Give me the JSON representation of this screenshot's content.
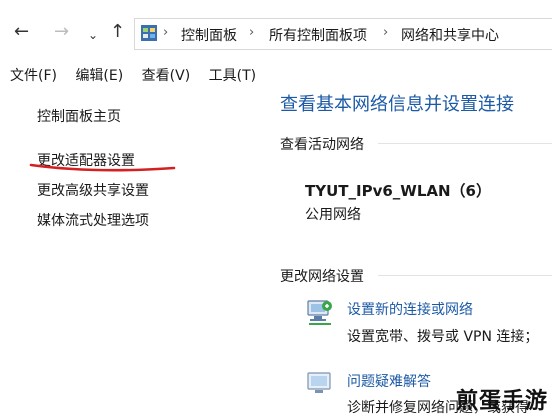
{
  "address": {
    "crumbs": [
      "控制面板",
      "所有控制面板项",
      "网络和共享中心"
    ]
  },
  "menu": [
    "文件(F)",
    "编辑(E)",
    "查看(V)",
    "工具(T)"
  ],
  "sidebar": {
    "items": [
      "控制面板主页",
      "更改适配器设置",
      "更改高级共享设置",
      "媒体流式处理选项"
    ]
  },
  "main": {
    "title": "查看基本网络信息并设置连接",
    "active_header": "查看活动网络",
    "network_name": "TYUT_IPv6_WLAN（6）",
    "network_type": "公用网络",
    "change_header": "更改网络设置",
    "tasks": [
      {
        "title": "设置新的连接或网络",
        "desc": "设置宽带、拨号或 VPN 连接；"
      },
      {
        "title": "问题疑难解答",
        "desc": "诊断并修复网络问题，或获得"
      }
    ]
  },
  "watermark": "煎蛋手游",
  "colors": {
    "link": "#1c5aa6",
    "annotation": "#d42020"
  }
}
